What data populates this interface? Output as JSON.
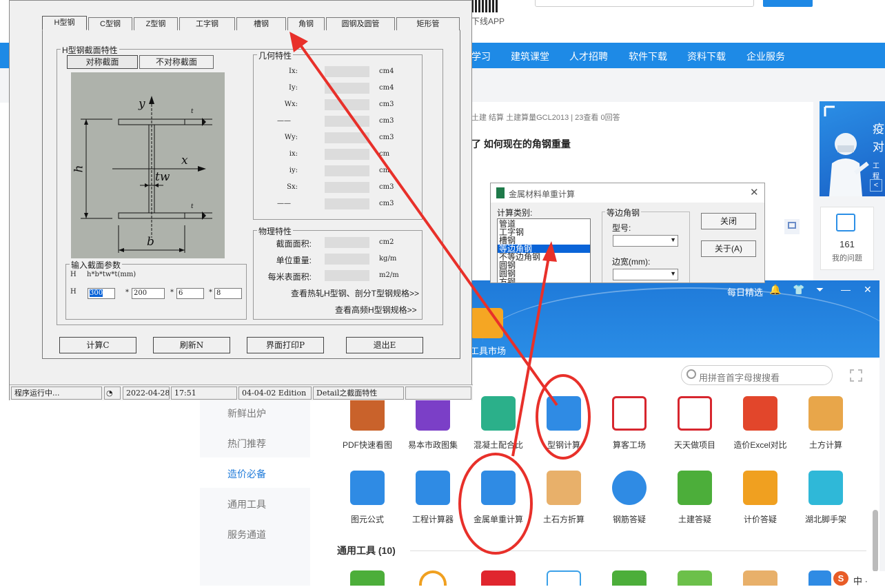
{
  "site": {
    "app_download": "下线APP",
    "nav": [
      "学习",
      "建筑课堂",
      "人才招聘",
      "软件下载",
      "资料下载",
      "企业服务"
    ],
    "post_meta": "土建 结算 土建算量GCL2013    |    23查看  0回答",
    "post_title": "了 如何现在的角钢重量",
    "banner_text": "疫对",
    "banner_small": "工程",
    "banner_nav": "<",
    "my_questions_count": "161",
    "my_questions_label": "我的问题"
  },
  "tools_window": {
    "daily_picks": "每日精选",
    "window_controls": [
      "🔔",
      "👕",
      "⏷",
      "—",
      "✕"
    ],
    "market_label": "工具市场",
    "sidebar": [
      "新鲜出炉",
      "热门推荐",
      "造价必备",
      "通用工具",
      "服务通道"
    ],
    "sidebar_active": "造价必备",
    "search_placeholder": "用拼音首字母搜搜看",
    "tools_row1": [
      "PDF快速看图",
      "易本市政图集",
      "混凝土配合比",
      "型钢计算",
      "算客工场",
      "天天做项目",
      "造价Excel对比",
      "土方计算"
    ],
    "tools_row2": [
      "图元公式",
      "工程计算器",
      "金属单重计算",
      "土石方折算",
      "钢筋答疑",
      "土建答疑",
      "计价答疑",
      "湖北脚手架"
    ],
    "section_title": "通用工具  (10)",
    "tray_text": "中 ·"
  },
  "metal_dialog": {
    "title": "金属材料单重计算",
    "close": "✕",
    "calc_type_label": "计算类别:",
    "calc_types": [
      "管道",
      "工字钢",
      "槽钢",
      "等边角钢",
      "不等边角钢",
      "圆钢",
      "圆钢",
      "方钢"
    ],
    "selected_type": "等边角钢",
    "group_label": "等边角钢",
    "model_label": "型号:",
    "width_label": "边宽(mm):",
    "close_button": "关闭",
    "about_button": "关于(A)"
  },
  "h_window": {
    "tabs": [
      "H型钢",
      "C型钢",
      "Z型钢",
      "工字钢",
      "槽钢",
      "角钢",
      "圆钢及圆管",
      "矩形管"
    ],
    "active_tab": "H型钢",
    "section_group": "H型钢截面特性",
    "symmetric_button": "对称截面",
    "asymmetric_button": "不对称截面",
    "diagram_labels": {
      "y": "y",
      "x": "x",
      "h": "h",
      "tw": "tw",
      "b": "b",
      "t": "t"
    },
    "geometry_group": "几何特性",
    "geometry": [
      {
        "name": "Ix:",
        "unit": "cm4"
      },
      {
        "name": "Iy:",
        "unit": "cm4"
      },
      {
        "name": "Wx:",
        "unit": "cm3"
      },
      {
        "name": "——",
        "unit": "cm3"
      },
      {
        "name": "Wy:",
        "unit": "cm3"
      },
      {
        "name": "ix:",
        "unit": "cm"
      },
      {
        "name": "iy:",
        "unit": "cm"
      },
      {
        "name": "Sx:",
        "unit": "cm3"
      },
      {
        "name": "——",
        "unit": "cm3"
      }
    ],
    "physical_group": "物理特性",
    "physical": [
      {
        "name": "截面面积:",
        "unit": "cm2"
      },
      {
        "name": "单位重量:",
        "unit": "kg/m"
      },
      {
        "name": "每米表面积:",
        "unit": "m2/m"
      }
    ],
    "link_hot_rolled": "查看热轧H型钢、剖分T型钢规格>>",
    "link_high_freq": "查看高频H型钢规格>>",
    "input_group": "输入截面参数",
    "input_formula_h": "H",
    "input_formula": "h*b*tw*t(mm)",
    "input_row_h": "H",
    "inputs": [
      "300",
      "200",
      "6",
      "8"
    ],
    "star": "*",
    "buttons": [
      "计算C",
      "刷新N",
      "界面打印P",
      "退出E"
    ],
    "status": [
      "程序运行中...",
      "2022-04-28",
      "17:51",
      "04-04-02 Edition",
      "Detail之截面特性"
    ]
  }
}
